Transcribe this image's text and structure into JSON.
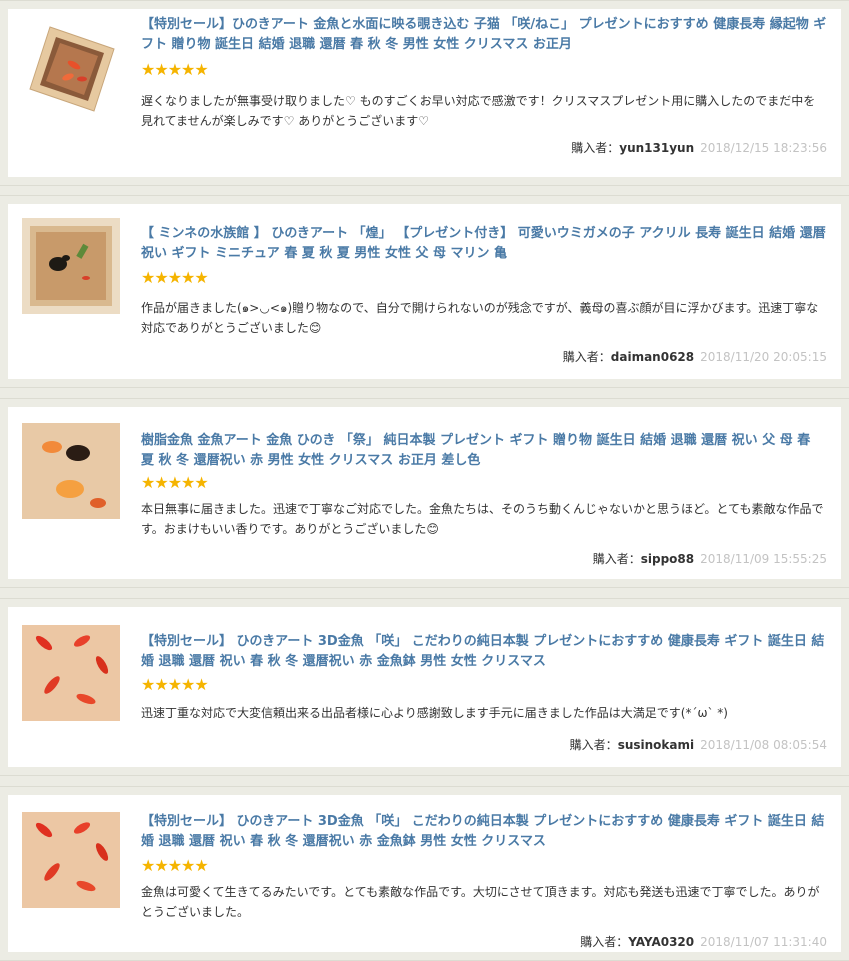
{
  "reviews": [
    {
      "title": "【特別セール】ひのきアート 金魚と水面に映る覗き込む 子猫 「咲/ねこ」 プレゼントにおすすめ 健康長寿 縁起物 ギフト 贈り物 誕生日 結婚 退職 還暦 春 秋 冬 男性 女性 クリスマス お正月",
      "stars": "★★★★★",
      "text": "遅くなりましたが無事受け取りました♡ ものすごくお早い対応で感激です！クリスマスプレゼント用に購入したのでまだ中を見れてませんが楽しみです♡ ありがとうございます♡",
      "buyer_label": "購入者：",
      "buyer": "yun131yun",
      "date": "2018/12/15 18:23:56"
    },
    {
      "title": "【 ミンネの水族館 】 ひのきアート 「煌」 【プレゼント付き】 可愛いウミガメの子 アクリル 長寿 誕生日 結婚 還暦 祝い ギフト ミニチュア 春 夏 秋 夏 男性 女性 父 母 マリン 亀",
      "stars": "★★★★★",
      "text": "作品が届きました(๑>◡<๑)贈り物なので、自分で開けられないのが残念ですが、義母の喜ぶ顔が目に浮かびます。迅速丁寧な対応でありがとうございました😊",
      "buyer_label": "購入者：",
      "buyer": "daiman0628",
      "date": "2018/11/20 20:05:15"
    },
    {
      "title": "樹脂金魚 金魚アート 金魚 ひのき 「祭」 純日本製 プレゼント ギフト 贈り物 誕生日 結婚 退職 還暦 祝い 父 母 春 夏 秋 冬 還暦祝い 赤 男性 女性 クリスマス お正月 差し色",
      "stars": "★★★★★",
      "text": "本日無事に届きました。迅速で丁寧なご対応でした。金魚たちは、そのうち動くんじゃないかと思うほど。とても素敵な作品です。おまけもいい香りです。ありがとうございました😊",
      "buyer_label": "購入者：",
      "buyer": "sippo88",
      "date": "2018/11/09 15:55:25"
    },
    {
      "title": "【特別セール】 ひのきアート 3D金魚 「咲」 こだわりの純日本製 プレゼントにおすすめ 健康長寿 ギフト 誕生日 結婚 退職 還暦 祝い 春 秋 冬 還暦祝い 赤 金魚鉢 男性 女性 クリスマス",
      "stars": "★★★★★",
      "text": "迅速丁重な対応で大変信頼出来る出品者様に心より感謝致します手元に届きました作品は大満足です(*´ω` *)",
      "buyer_label": "購入者：",
      "buyer": "susinokami",
      "date": "2018/11/08 08:05:54"
    },
    {
      "title": "【特別セール】 ひのきアート 3D金魚 「咲」 こだわりの純日本製 プレゼントにおすすめ 健康長寿 ギフト 誕生日 結婚 退職 還暦 祝い 春 秋 冬 還暦祝い 赤 金魚鉢 男性 女性 クリスマス",
      "stars": "★★★★★",
      "text": "金魚は可愛くて生きてるみたいです。とても素敵な作品です。大切にさせて頂きます。対応も発送も迅速で丁寧でした。ありがとうございました。",
      "buyer_label": "購入者：",
      "buyer": "YAYA0320",
      "date": "2018/11/07 11:31:40"
    }
  ]
}
